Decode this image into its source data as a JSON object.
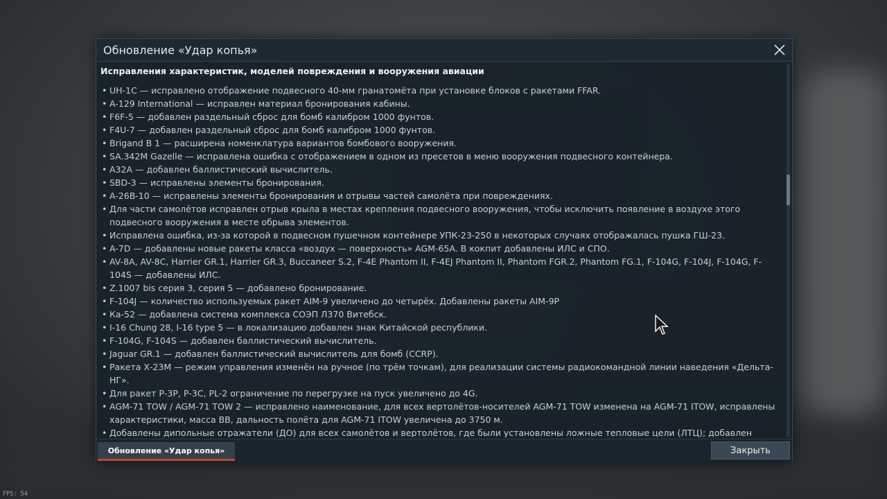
{
  "dialog": {
    "title": "Обновление «Удар копья»",
    "section_title": "Исправления характеристик, моделей повреждения и вооружения авиации",
    "items": [
      "UH-1C — исправлено отображение подвесного 40-мм гранатомёта при установке блоков с ракетами FFAR.",
      "A-129 International — исправлен материал бронирования кабины.",
      "F6F-5 — добавлен раздельный сброс для бомб калибром 1000 фунтов.",
      "F4U-7 — добавлен раздельный сброс для бомб калибром 1000 фунтов.",
      "Brigand B 1 — расширена номенклатура вариантов бомбового вооружения.",
      "SA.342M Gazelle — исправлена ошибка с отображением в одном из пресетов в меню вооружения подвесного контейнера.",
      "A32A — добавлен баллистический вычислитель.",
      "SBD-3 — исправлены элементы бронирования.",
      "A-26B-10 — исправлены элементы бронирования и отрывы частей самолёта при повреждениях.",
      "Для части самолётов исправлен отрыв крыла в местах крепления подвесного вооружения, чтобы исключить появление в воздухе этого подвесного вооружения в месте обрыва элементов.",
      "Исправлена ошибка, из-за которой в подвесном пушечном контейнере УПК-23-250 в некоторых случаях отображалась пушка ГШ-23.",
      "A-7D — добавлены новые ракеты класса «воздух — поверхность» AGM-65A. В кокпит добавлены ИЛС и СПО.",
      "AV-8A, AV-8C, Harrier GR.1, Harrier GR.3, Buccaneer S.2, F-4E Phantom II, F-4EJ Phantom II, Phantom FGR.2, Phantom FG.1, F-104G, F-104J, F-104G, F-104S — добавлены ИЛС.",
      "Z.1007 bis серия 3, серия 5 — добавлено бронирование.",
      "F-104J — количество используемых ракет AIM-9 увеличено до четырёх. Добавлены ракеты AIM-9P",
      "Ка-52 — добавлена система комплекса СОЭП Л370 Витебск.",
      "I-16 Chung 28, I-16 type 5 — в локализацию добавлен знак Китайской республики.",
      "F-104G, F-104S — добавлен баллистический вычислитель.",
      "Jaguar GR.1 — добавлен баллистический вычислитель для бомб (CCRP).",
      "Ракета Х-23М — режим управления изменён на ручное (по трём точкам), для реализации системы радиокомандной линии наведения «Дельта-НГ».",
      "Для ракет Р-3Р, Р-3С, PL-2 ограничение по перегрузке на пуск увеличено до 4G.",
      "AGM-71 TOW / AGM-71 TOW 2 — исправлено наименование, для всех вертолётов-носителей AGM-71 TOW изменена на AGM-71 ITOW, исправлены характеристики, масса ВВ, дальность полёта для AGM-71 ITOW увеличена до 3750 м.",
      "Добавлены дипольные отражатели (ДО) для всех самолётов и вертолётов, где были установлены ложные тепловые цели (ЛТЦ); добавлен различный выбор соотношения ЛТЦ и ДО, только ДО или только ЛТЦ."
    ],
    "footer": {
      "tab_label": "Обновление «Удар копья»",
      "close_label": "Закрыть"
    }
  },
  "fps_text": "FPS: 54",
  "colors": {
    "accent": "#c2452d",
    "panel": "#182129",
    "text": "#c9d0d6"
  }
}
